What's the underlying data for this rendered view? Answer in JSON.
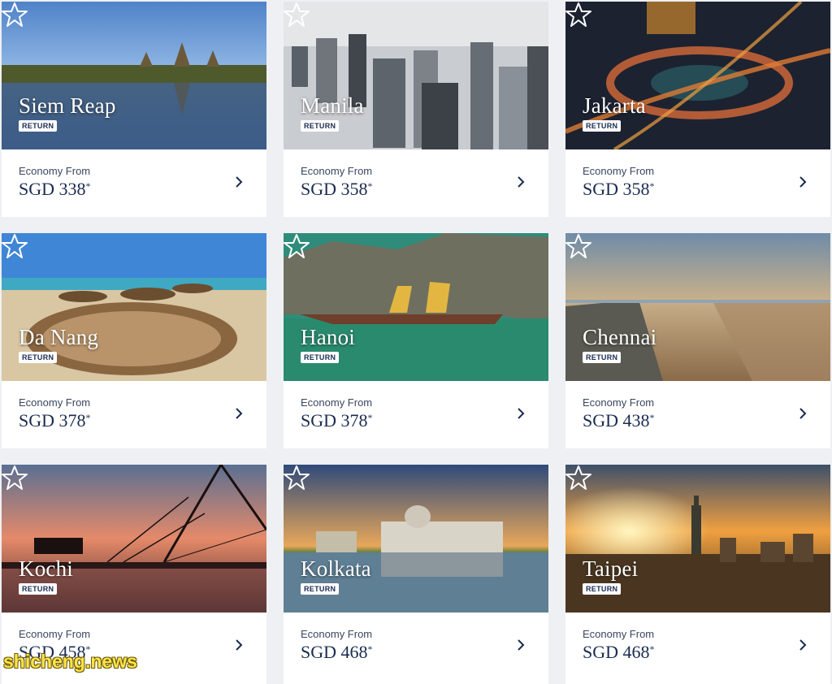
{
  "destinations": [
    {
      "city": "Siem Reap",
      "badge": "RETURN",
      "from_label": "Economy From",
      "price": "SGD 338",
      "price_mark": "*"
    },
    {
      "city": "Manila",
      "badge": "RETURN",
      "from_label": "Economy From",
      "price": "SGD 358",
      "price_mark": "*"
    },
    {
      "city": "Jakarta",
      "badge": "RETURN",
      "from_label": "Economy From",
      "price": "SGD 358",
      "price_mark": "*"
    },
    {
      "city": "Da Nang",
      "badge": "RETURN",
      "from_label": "Economy From",
      "price": "SGD 378",
      "price_mark": "*"
    },
    {
      "city": "Hanoi",
      "badge": "RETURN",
      "from_label": "Economy From",
      "price": "SGD 378",
      "price_mark": "*"
    },
    {
      "city": "Chennai",
      "badge": "RETURN",
      "from_label": "Economy From",
      "price": "SGD 438",
      "price_mark": "*"
    },
    {
      "city": "Kochi",
      "badge": "RETURN",
      "from_label": "Economy From",
      "price": "SGD 458",
      "price_mark": "*"
    },
    {
      "city": "Kolkata",
      "badge": "RETURN",
      "from_label": "Economy From",
      "price": "SGD 468",
      "price_mark": "*"
    },
    {
      "city": "Taipei",
      "badge": "RETURN",
      "from_label": "Economy From",
      "price": "SGD 468",
      "price_mark": "*"
    }
  ],
  "watermark": "shicheng.news",
  "icons": {
    "favorite": "star-outline-icon",
    "go": "chevron-right-icon"
  },
  "colors": {
    "text_dark": "#1a2b50",
    "card_bg": "#ffffff",
    "page_bg": "#eef0f3",
    "watermark": "#ffe44d"
  }
}
